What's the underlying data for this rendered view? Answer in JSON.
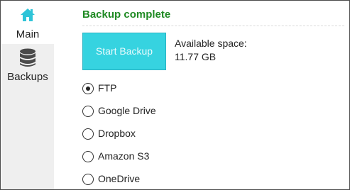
{
  "sidebar": {
    "items": [
      {
        "label": "Main",
        "icon": "home-icon",
        "active": true
      },
      {
        "label": "Backups",
        "icon": "database-icon",
        "active": false
      }
    ]
  },
  "main": {
    "status": "Backup complete",
    "start_button": "Start Backup",
    "space_label": "Available space:",
    "space_value": "11.77 GB",
    "destinations": [
      {
        "label": "FTP",
        "selected": true
      },
      {
        "label": "Google Drive",
        "selected": false
      },
      {
        "label": "Dropbox",
        "selected": false
      },
      {
        "label": "Amazon S3",
        "selected": false
      },
      {
        "label": "OneDrive",
        "selected": false
      }
    ]
  },
  "colors": {
    "accent_green": "#1f8a23",
    "button_cyan": "#36d3e0",
    "sidebar_bg": "#efefef"
  }
}
